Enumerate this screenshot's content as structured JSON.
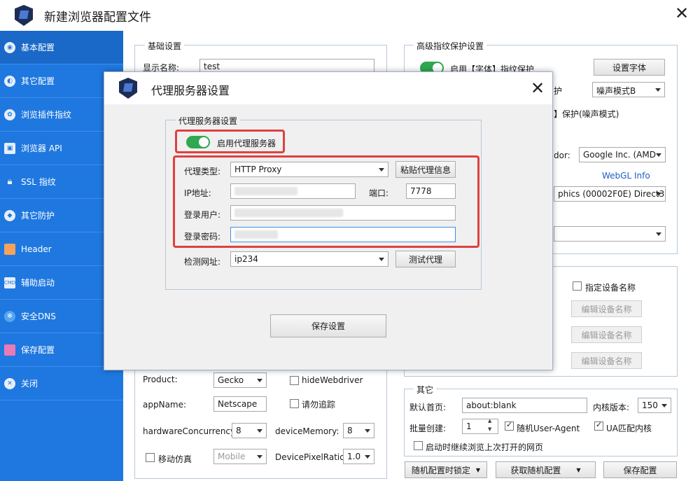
{
  "window": {
    "title": "新建浏览器配置文件"
  },
  "sidebar": {
    "items": [
      {
        "label": "基本配置"
      },
      {
        "label": "其它配置"
      },
      {
        "label": "浏览插件指纹"
      },
      {
        "label": "浏览器 API"
      },
      {
        "label": "SSL 指纹"
      },
      {
        "label": "其它防护"
      },
      {
        "label": "Header"
      },
      {
        "label": "辅助启动"
      },
      {
        "label": "安全DNS"
      },
      {
        "label": "保存配置"
      },
      {
        "label": "关闭"
      }
    ]
  },
  "basic": {
    "title": "基础设置",
    "display_name_label": "显示名称:",
    "display_name_value": "test",
    "product_label": "Product:",
    "product_value": "Gecko",
    "hide_webdriver": "hideWebdriver",
    "appname_label": "appName:",
    "appname_value": "Netscape",
    "dnt_label": "请勿追踪",
    "hw_label": "hardwareConcurrency:",
    "hw_value": "8",
    "mem_label": "deviceMemory:",
    "mem_value": "8",
    "mobile_label": "移动仿真",
    "mobile_value": "Mobile",
    "dpr_label": "DevicePixelRatio:",
    "dpr_value": "1.0"
  },
  "advanced": {
    "title": "高级指纹保护设置",
    "font_protect": "启用【字体】指纹保护",
    "set_font_btn": "设置字体",
    "noise_partial": "护",
    "noise_mode": "噪声模式B",
    "protect_partial": "】保护(噪声模式)",
    "vendor_partial": "dor:",
    "vendor_value": "Google Inc. (AMD",
    "webgl_link": "WebGL Info",
    "renderer_value": "phics (00002F0E) Direct3D1"
  },
  "device": {
    "set_name": "指定设备名称",
    "edit_btn": "编辑设备名称"
  },
  "other": {
    "title": "其它",
    "homepage_label": "默认首页:",
    "homepage_value": "about:blank",
    "kernel_label": "内核版本:",
    "kernel_value": "150",
    "batch_label": "批量创建:",
    "batch_value": "1",
    "random_ua": "随机User-Agent",
    "ua_match": "UA匹配内核",
    "continue_browse": "启动时继续浏览上次打开的网页"
  },
  "bottom": {
    "lock_btn": "随机配置时锁定",
    "random_btn": "获取随机配置",
    "save_btn": "保存配置"
  },
  "dialog": {
    "title": "代理服务器设置",
    "group_title": "代理服务器设置",
    "enable_proxy": "启用代理服务器",
    "type_label": "代理类型:",
    "type_value": "HTTP Proxy",
    "paste_btn": "粘贴代理信息",
    "ip_label": "IP地址:",
    "port_label": "端口:",
    "port_value": "7778",
    "user_label": "登录用户:",
    "pass_label": "登录密码:",
    "check_label": "检测网址:",
    "check_value": "ip234",
    "test_btn": "测试代理",
    "save_btn": "保存设置"
  },
  "colors": {
    "sidebar": "#1f78e0",
    "toggle_on": "#2fa84f",
    "highlight": "#e0403f",
    "link": "#1d5fc4"
  }
}
